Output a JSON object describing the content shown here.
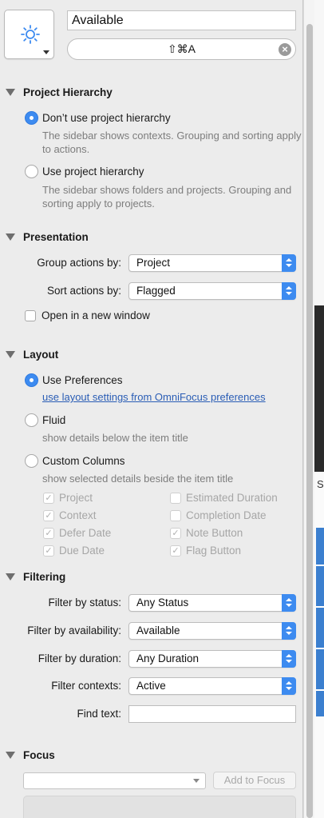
{
  "header": {
    "context_name": "Available",
    "shortcut": "⇧⌘A",
    "icon": "sun-icon",
    "clear_icon": "clear-circle-icon"
  },
  "project_hierarchy": {
    "title": "Project Hierarchy",
    "options": [
      {
        "label": "Don’t use project hierarchy",
        "description": "The sidebar shows contexts. Grouping and sorting apply to actions.",
        "selected": true
      },
      {
        "label": "Use project hierarchy",
        "description": "The sidebar shows folders and projects. Grouping and sorting apply to projects.",
        "selected": false
      }
    ]
  },
  "presentation": {
    "title": "Presentation",
    "group_label": "Group actions by:",
    "group_value": "Project",
    "sort_label": "Sort actions by:",
    "sort_value": "Flagged",
    "new_window_label": "Open in a new window",
    "new_window_checked": false
  },
  "layout": {
    "title": "Layout",
    "use_prefs_label": "Use Preferences",
    "use_prefs_link": "use layout settings from OmniFocus preferences",
    "fluid_label": "Fluid",
    "fluid_desc": "show details below the item title",
    "custom_label": "Custom Columns",
    "custom_desc": "show selected details beside the item title",
    "columns_left": [
      {
        "label": "Project",
        "checked": true
      },
      {
        "label": "Context",
        "checked": true
      },
      {
        "label": "Defer Date",
        "checked": true
      },
      {
        "label": "Due Date",
        "checked": true
      }
    ],
    "columns_right": [
      {
        "label": "Estimated Duration",
        "checked": false
      },
      {
        "label": "Completion Date",
        "checked": false
      },
      {
        "label": "Note Button",
        "checked": true
      },
      {
        "label": "Flag Button",
        "checked": true
      }
    ]
  },
  "filtering": {
    "title": "Filtering",
    "status_label": "Filter by status:",
    "status_value": "Any Status",
    "availability_label": "Filter by availability:",
    "availability_value": "Available",
    "duration_label": "Filter by duration:",
    "duration_value": "Any Duration",
    "contexts_label": "Filter contexts:",
    "contexts_value": "Active",
    "find_label": "Find text:",
    "find_value": ""
  },
  "focus": {
    "title": "Focus",
    "combo_value": "",
    "add_button": "Add to Focus"
  },
  "background": {
    "partial_letter": "S"
  },
  "colors": {
    "accent": "#3d8bf0",
    "link": "#2a5db5",
    "panel_bg": "#ececec"
  }
}
